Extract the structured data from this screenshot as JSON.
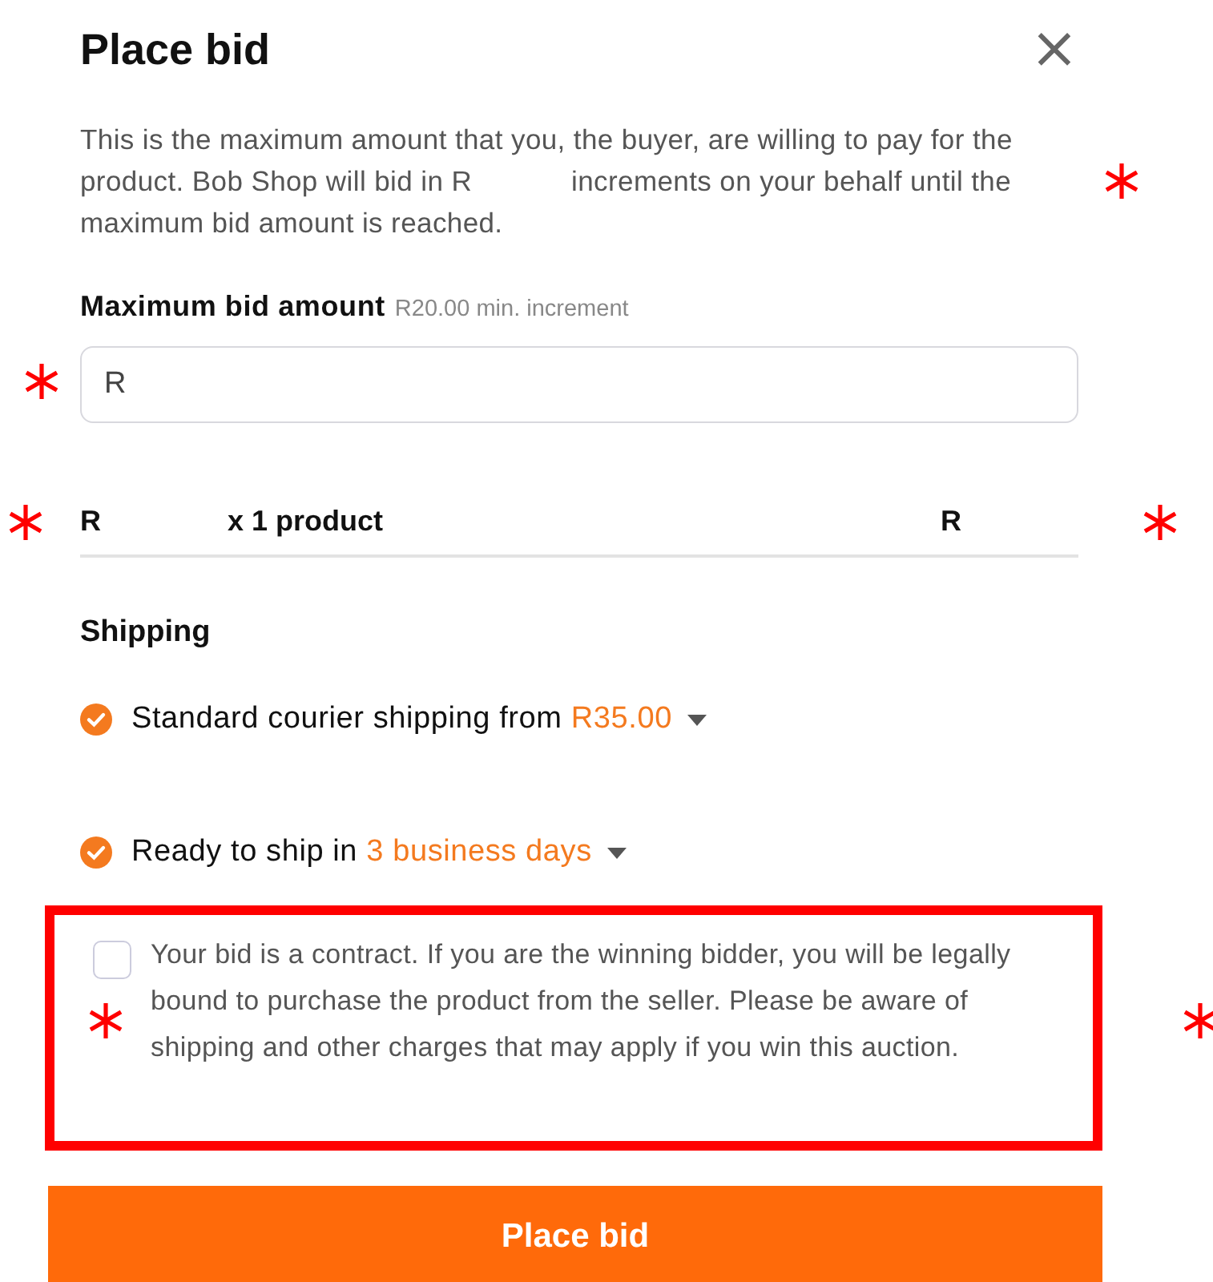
{
  "dialog": {
    "title": "Place bid",
    "close": "×"
  },
  "intro": {
    "before": "This is the maximum amount that you, the buyer, are willing to pay for the product. Bob Shop will bid in R",
    "after": "increments on your behalf until the maximum bid amount is reached."
  },
  "bid_field": {
    "label": "Maximum bid amount",
    "hint": "R20.00 min. increment",
    "value": "R"
  },
  "summary": {
    "price": "R",
    "quantity": "x 1 product",
    "total": "R"
  },
  "shipping": {
    "heading": "Shipping",
    "options": [
      {
        "label": "Standard courier shipping from",
        "value": "R35.00",
        "checked": true
      },
      {
        "label": "Ready to ship in",
        "value": "3 business days",
        "checked": true
      }
    ]
  },
  "terms": {
    "checked": false,
    "highlighted": true,
    "text": "Your bid is a contract. If you are the winning bidder, you will be legally bound to purchase the product from the seller. Please be aware of shipping and other charges that may apply if you win this auction."
  },
  "submit": {
    "label": "Place bid"
  }
}
